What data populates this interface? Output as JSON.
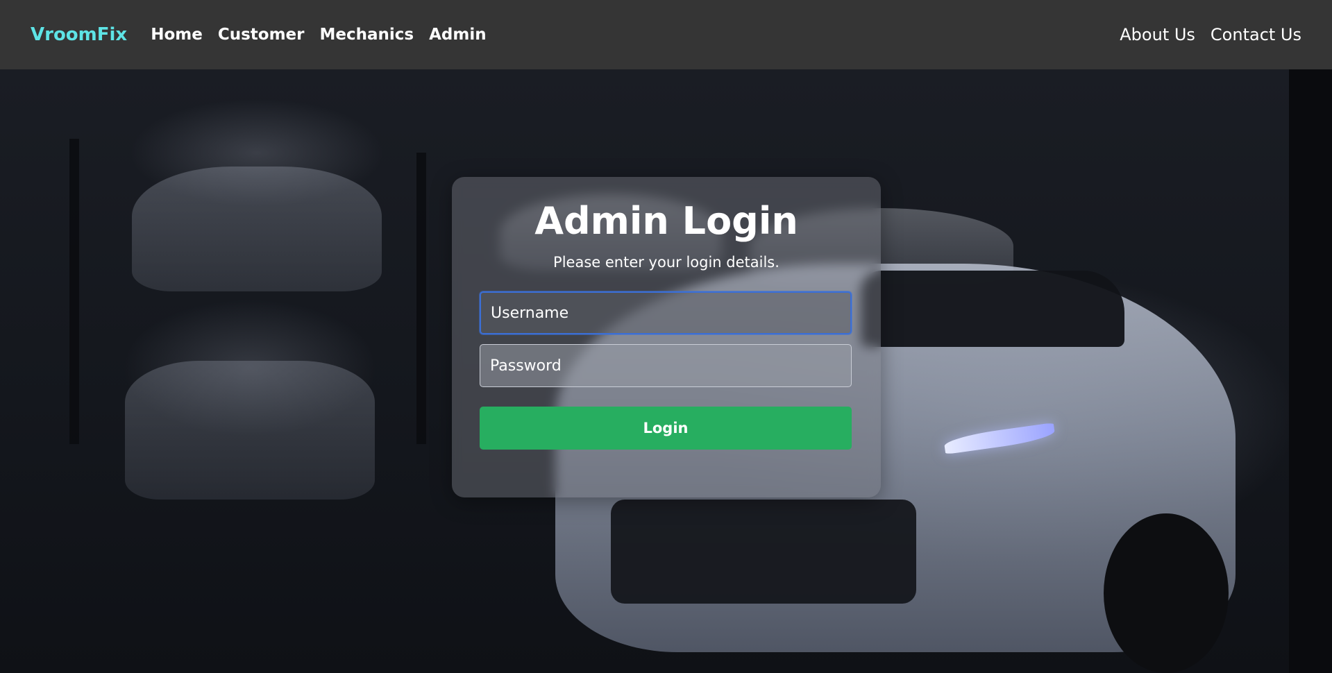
{
  "nav": {
    "brand": "VroomFix",
    "left_links": [
      "Home",
      "Customer",
      "Mechanics",
      "Admin"
    ],
    "right_links": [
      "About Us",
      "Contact Us"
    ]
  },
  "login": {
    "title": "Admin Login",
    "subtitle": "Please enter your login details.",
    "username_placeholder": "Username",
    "password_placeholder": "Password",
    "button_label": "Login"
  },
  "colors": {
    "navbar_bg": "#353535",
    "brand": "#5ee4e6",
    "button": "#27ae60",
    "focus_border": "#3b6fd6"
  }
}
